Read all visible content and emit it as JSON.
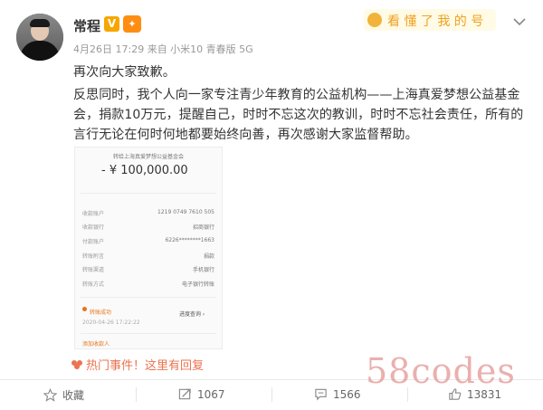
{
  "post": {
    "username": "常程",
    "verified_label": "V",
    "level_label": "🔱",
    "meta": "4月26日 17:29 来自 小米10 青春版 5G",
    "paragraph1": "再次向大家致歉。",
    "paragraph2_line1": "反思同时，我个人向一家专注青少年教育的公益机构——上海真爱梦想公益基金",
    "paragraph2_line2": "会，捐款10万元，提醒自己，时时不忘这次的教训，时时不忘社会责任，所有的",
    "paragraph2_line3": "言行无论在何时何地都要始终向善，再次感谢大家监督帮助。"
  },
  "transfer_card": {
    "header": "转给上海真爱梦想公益基金会",
    "amount": "- ¥ 100,000.00",
    "rows": [
      {
        "label": "收款账户",
        "value": "1219 0749 7610 505"
      },
      {
        "label": "收款银行",
        "value": "招商银行"
      },
      {
        "label": "付款账户",
        "value": "6226********1663"
      },
      {
        "label": "转账附言",
        "value": "捐款"
      },
      {
        "label": "转账渠道",
        "value": "手机银行"
      },
      {
        "label": "转账方式",
        "value": "电子银行转账"
      }
    ],
    "status": "转账成功",
    "time": "2020-04-26 17:22:22",
    "status_action": "进度查询 ›",
    "footer_link": "添加收款人"
  },
  "hot_event": "热门事件！这里有回复",
  "actions": {
    "favorite": "收藏",
    "repost": "1067",
    "comment": "1566",
    "like": "13831"
  },
  "watermark": "58codes",
  "colors": {
    "verified_badge": "#f7a600",
    "hot_event": "#eb7350",
    "status": "#e8741a"
  }
}
